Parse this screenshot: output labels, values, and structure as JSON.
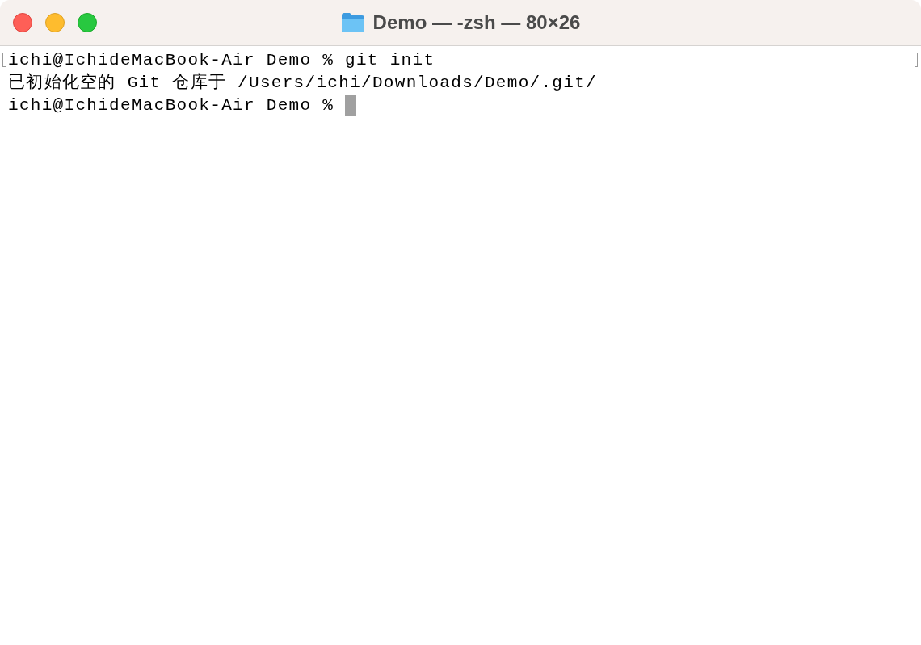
{
  "window": {
    "title": "Demo — -zsh — 80×26"
  },
  "terminal": {
    "lines": [
      {
        "text": "ichi@IchideMacBook-Air Demo % git init",
        "marked": true,
        "cursor": false
      },
      {
        "text": "已初始化空的 Git 仓库于 /Users/ichi/Downloads/Demo/.git/",
        "marked": false,
        "cursor": false
      },
      {
        "text": "ichi@IchideMacBook-Air Demo %",
        "marked": false,
        "cursor": true
      }
    ]
  }
}
